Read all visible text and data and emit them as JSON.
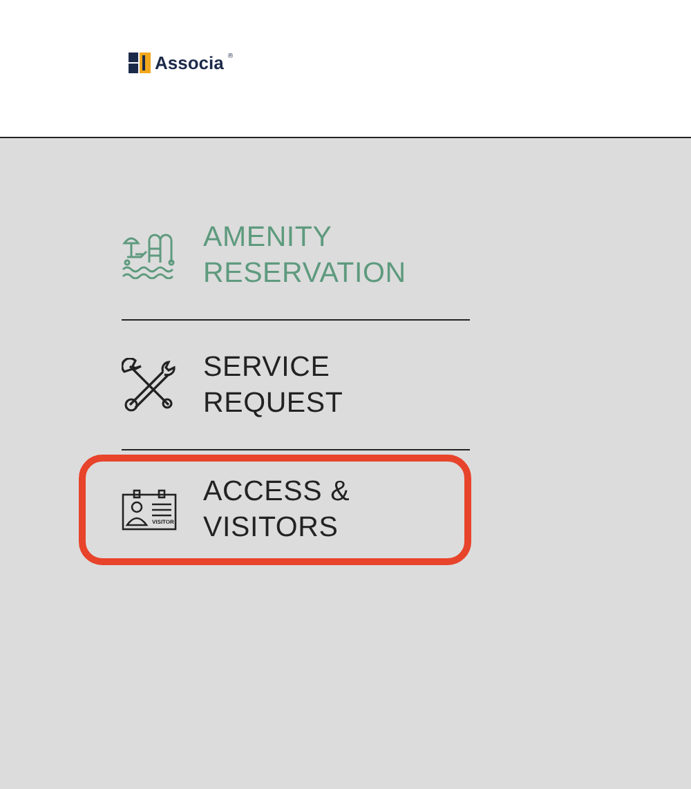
{
  "logo": {
    "name": "Associa",
    "mark": "®"
  },
  "menu": [
    {
      "kind": "amenity",
      "label": "AMENITY RESERVATION",
      "selected": true,
      "highlighted": false
    },
    {
      "kind": "service",
      "label": "SERVICE REQUEST",
      "selected": false,
      "highlighted": false
    },
    {
      "kind": "access",
      "label": "ACCESS & VISITORS",
      "selected": false,
      "highlighted": true,
      "icon_text": "VISITOR"
    }
  ]
}
